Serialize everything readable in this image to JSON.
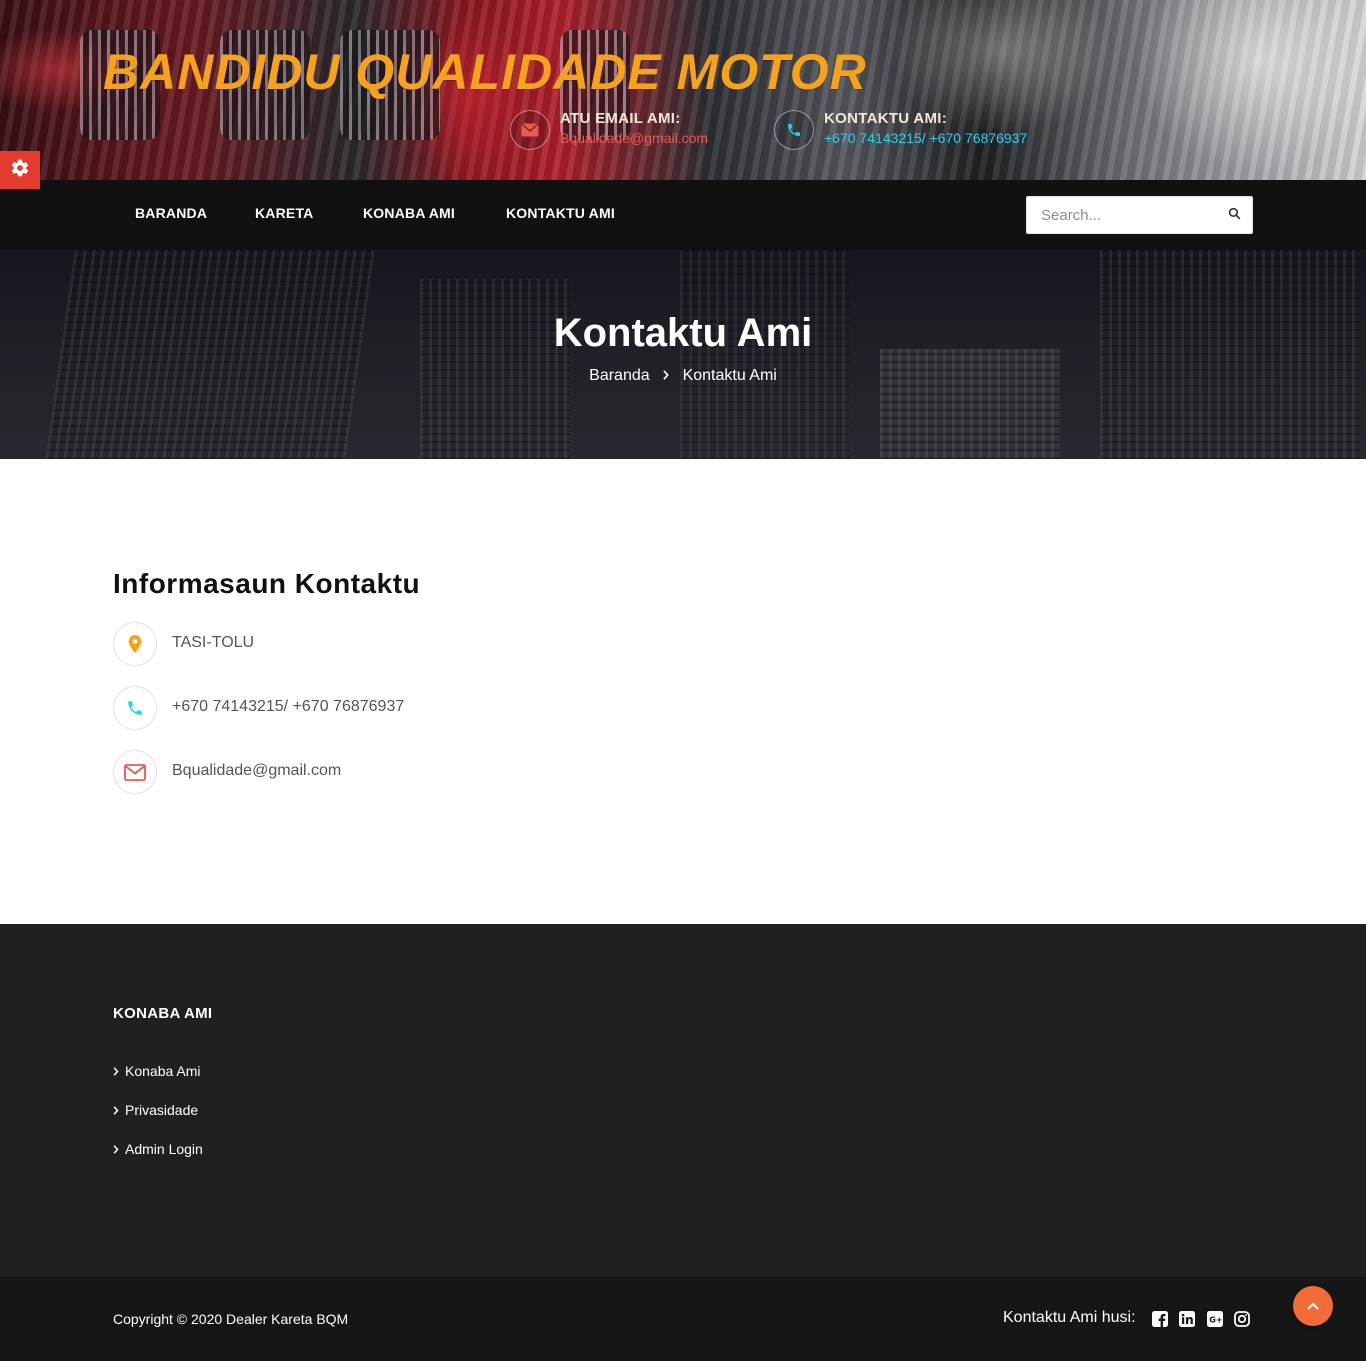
{
  "header": {
    "site_title": "BANDIDU QUALIDADE MOTOR",
    "email_label": "ATU EMAIL AMI:",
    "email_value": "Bqualidade@gmail.com",
    "phone_label": "KONTAKTU AMI:",
    "phone_value": "+670 74143215/ +670 76876937"
  },
  "nav": {
    "items": [
      {
        "label": "BARANDA"
      },
      {
        "label": "KARETA"
      },
      {
        "label": "KONABA AMI"
      },
      {
        "label": "KONTAKTU AMI"
      }
    ],
    "search_placeholder": "Search..."
  },
  "banner": {
    "title": "Kontaktu Ami",
    "breadcrumb_home": "Baranda",
    "breadcrumb_current": "Kontaktu Ami"
  },
  "contact": {
    "heading": "Informasaun Kontaktu",
    "address": "TASI-TOLU",
    "phone": "+670 74143215/ +670 76876937",
    "email": "Bqualidade@gmail.com"
  },
  "footer": {
    "heading": "KONABA AMI",
    "links": [
      {
        "label": "Konaba Ami"
      },
      {
        "label": "Privasidade"
      },
      {
        "label": "Admin Login"
      }
    ],
    "copyright": "Copyright © 2020 Dealer Kareta BQM",
    "social_label": "Kontaktu Ami husi:",
    "social_icons": [
      "facebook-icon",
      "linkedin-icon",
      "google-plus-icon",
      "instagram-icon"
    ]
  },
  "colors": {
    "title_orange": "#f7a21b",
    "email_red": "#e85a54",
    "phone_cyan": "#21d4ef",
    "settings_red": "#e33b2e",
    "scroll_top_orange": "#f26b38",
    "nav_bg": "#111111",
    "footer_bg": "#202020"
  }
}
